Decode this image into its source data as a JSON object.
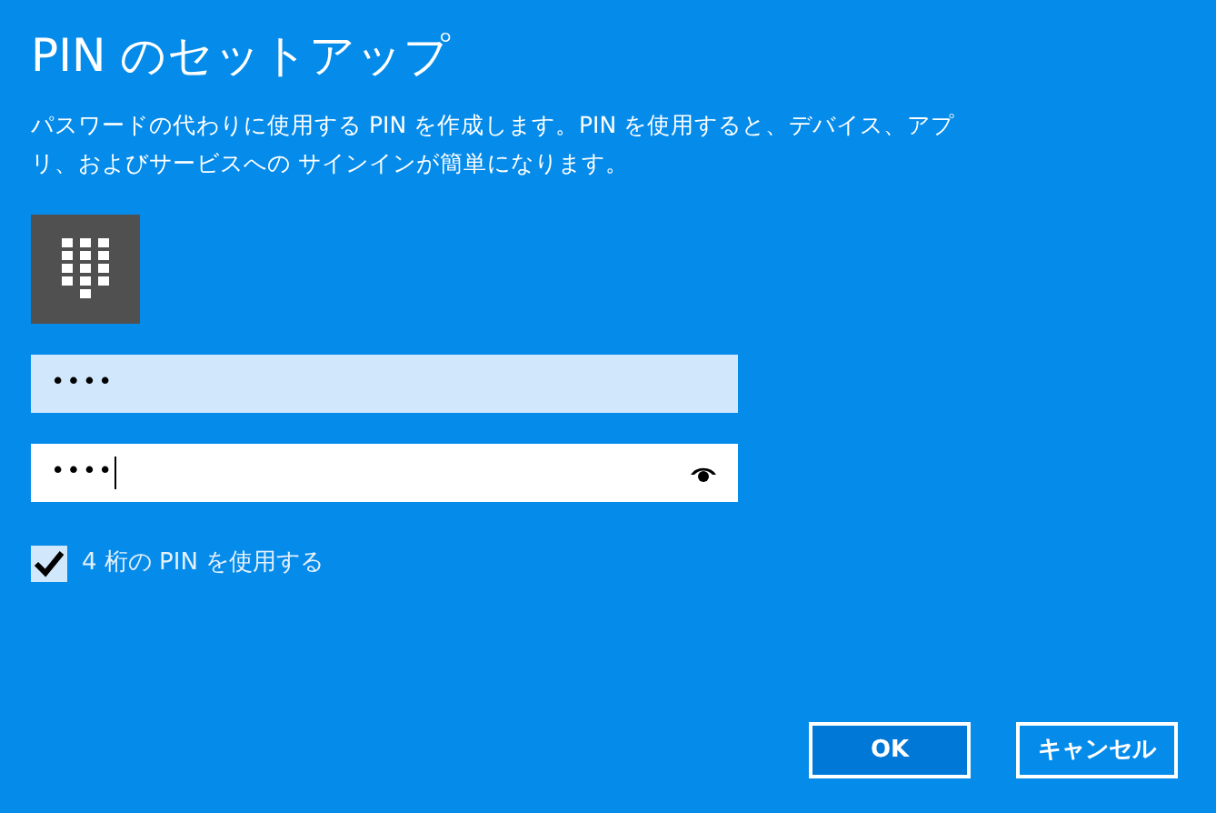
{
  "title": "PIN のセットアップ",
  "description": "パスワードの代わりに使用する PIN を作成します。PIN を使用すると、デバイス、アプリ、およびサービスへの サインインが簡単になります。",
  "fields": [
    {
      "value": "••••",
      "focused": false
    },
    {
      "value": "••••",
      "focused": true
    }
  ],
  "checkbox": {
    "label": "4 桁の PIN を使用する",
    "checked": true
  },
  "buttons": [
    {
      "label": "OK",
      "kind": "primary"
    },
    {
      "label": "キャンセル",
      "kind": "secondary"
    }
  ]
}
